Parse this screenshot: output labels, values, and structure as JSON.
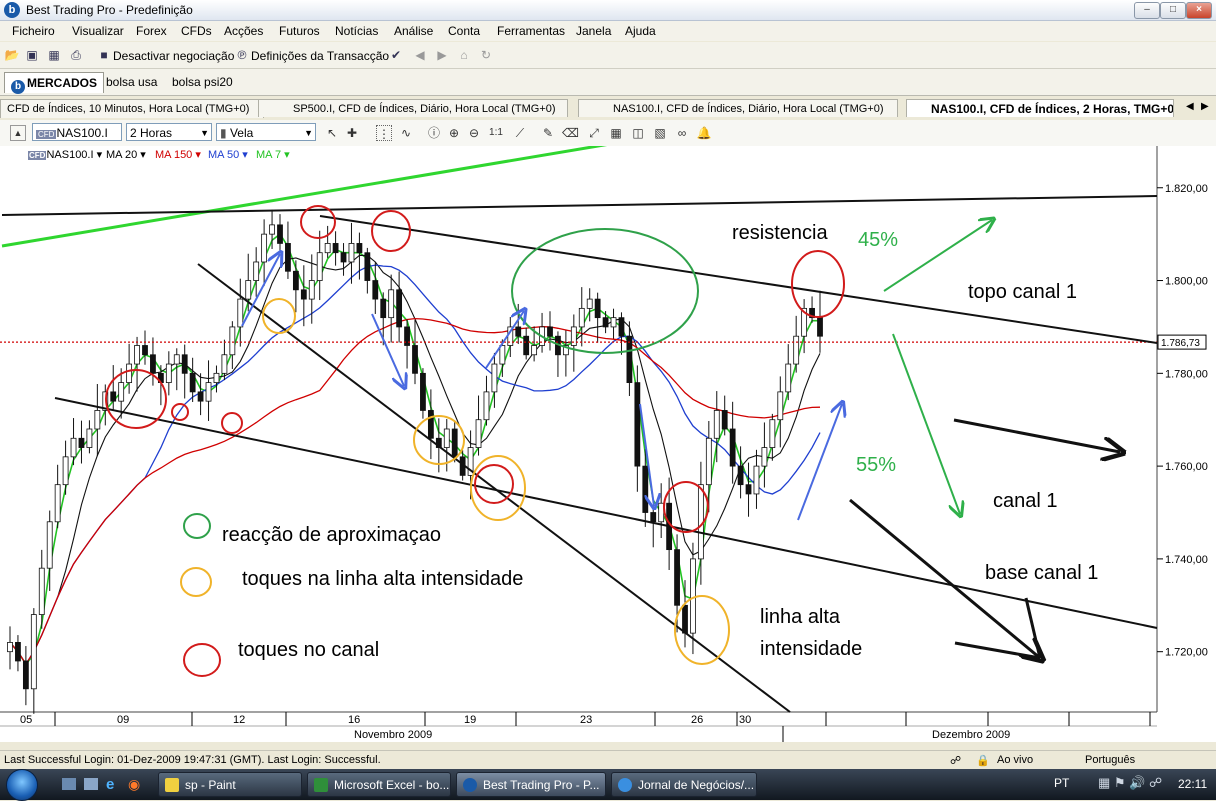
{
  "window": {
    "title": "Best Trading Pro - Predefinição",
    "app_icon": "b"
  },
  "menu": [
    "Ficheiro",
    "Visualizar",
    "Forex",
    "CFDs",
    "Acções",
    "Futuros",
    "Notícias",
    "Análise",
    "Conta",
    "Ferramentas",
    "Janela",
    "Ajuda"
  ],
  "toolbar": {
    "deactivate_label": "Desactivar negociação",
    "settings_label": "Definições da Transacção"
  },
  "market_tabs": [
    {
      "label": "MERCADOS",
      "logo": "b"
    },
    {
      "label": "bolsa usa"
    },
    {
      "label": "bolsa psi20"
    }
  ],
  "chart_tabs": [
    "CFD de Índices, 10 Minutos, Hora Local (TMG+0)",
    "SP500.I, CFD de Índices, Diário, Hora Local (TMG+0)",
    "NAS100.I, CFD de Índices, Diário, Hora Local (TMG+0)",
    "NAS100.I, CFD de Índices, 2 Horas, TMG+0"
  ],
  "chart_toolbar": {
    "symbol": "NAS100.I",
    "timeframe": "2 Horas",
    "chart_type": "Vela",
    "symbol_tag": "CFD"
  },
  "indicators": [
    {
      "label": "NAS100.I",
      "color": "#000000"
    },
    {
      "label": "MA 20",
      "color": "#000000"
    },
    {
      "label": "MA 150",
      "color": "#d00000"
    },
    {
      "label": "MA 50",
      "color": "#1f3fd0"
    },
    {
      "label": "MA 7",
      "color": "#22c322"
    }
  ],
  "annotations": {
    "resistencia": "resistencia",
    "pct_up": "45%",
    "pct_down": "55%",
    "topo_canal": "topo canal 1",
    "canal": "canal 1",
    "base_canal": "base canal 1",
    "linha_alta_1": "linha alta",
    "linha_alta_2": "intensidade",
    "legend_green": "reacção de aproximaçao",
    "legend_orange": "toques na linha alta intensidade",
    "legend_red": "toques no canal"
  },
  "chart_data": {
    "type": "candlestick",
    "y_ticks": [
      "1.820,00",
      "1.800,00",
      "1.780,00",
      "1.760,00",
      "1.740,00",
      "1.720,00"
    ],
    "y_values": [
      1820,
      1800,
      1780,
      1760,
      1740,
      1720
    ],
    "ylim": [
      1707,
      1829
    ],
    "current_price": "1.786,73",
    "current_value": 1786.73,
    "x_ticks": [
      "05",
      "09",
      "12",
      "16",
      "19",
      "23",
      "26",
      "30"
    ],
    "x_month_labels": [
      "Novembro 2009",
      "Dezembro 2009"
    ],
    "close_path": [
      1722,
      1718,
      1712,
      1728,
      1738,
      1748,
      1756,
      1762,
      1766,
      1764,
      1768,
      1772,
      1776,
      1774,
      1778,
      1782,
      1786,
      1784,
      1780,
      1778,
      1782,
      1784,
      1780,
      1776,
      1774,
      1778,
      1780,
      1784,
      1790,
      1796,
      1800,
      1804,
      1810,
      1812,
      1808,
      1802,
      1798,
      1796,
      1800,
      1806,
      1808,
      1806,
      1804,
      1808,
      1806,
      1800,
      1796,
      1792,
      1798,
      1790,
      1786,
      1780,
      1772,
      1766,
      1764,
      1768,
      1762,
      1758,
      1764,
      1770,
      1776,
      1782,
      1786,
      1790,
      1788,
      1784,
      1786,
      1790,
      1788,
      1784,
      1786,
      1790,
      1794,
      1796,
      1792,
      1790,
      1792,
      1788,
      1778,
      1760,
      1750,
      1748,
      1752,
      1742,
      1730,
      1724,
      1740,
      1756,
      1766,
      1772,
      1768,
      1760,
      1756,
      1754,
      1760,
      1764,
      1770,
      1776,
      1782,
      1788,
      1794,
      1792,
      1788
    ]
  },
  "status": {
    "login": "Last Successful Login: 01-Dez-2009 19:47:31 (GMT). Last Login: Successful.",
    "live": "Ao vivo",
    "language": "Português"
  },
  "taskbar": {
    "items": [
      "sp - Paint",
      "Microsoft Excel - bo...",
      "Best Trading Pro - P...",
      "Jornal de Negócios/..."
    ],
    "lang": "PT",
    "clock": "22:11"
  }
}
